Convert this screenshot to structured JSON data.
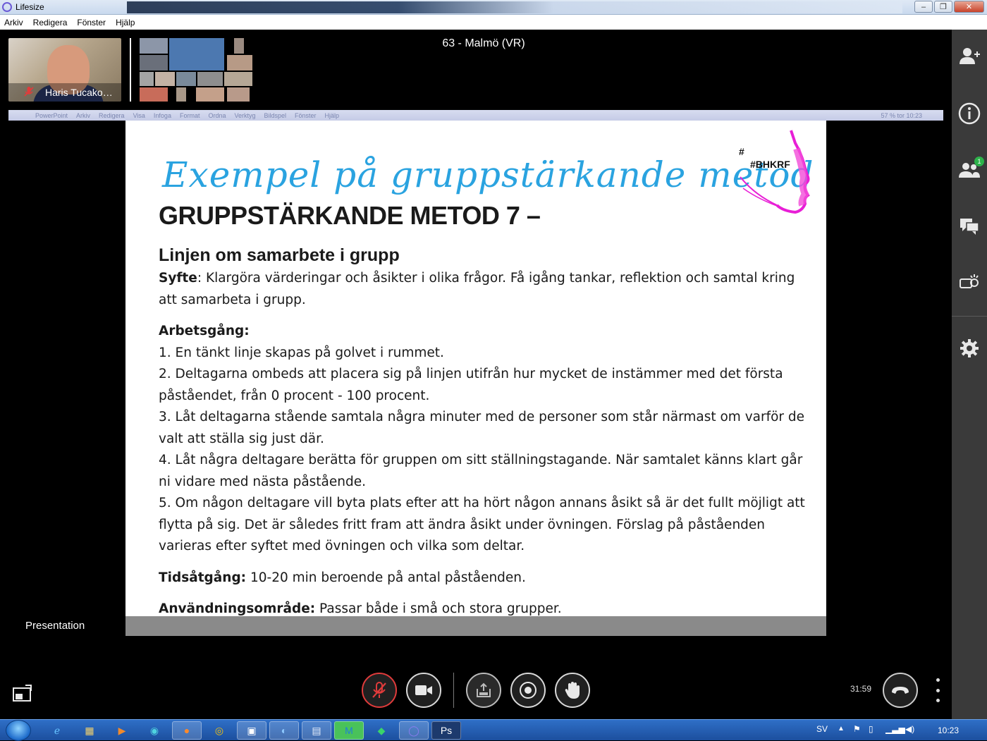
{
  "window": {
    "title": "Lifesize",
    "controls": {
      "minimize": "–",
      "maximize": "❐",
      "close": "✕"
    }
  },
  "menu": [
    "Arkiv",
    "Redigera",
    "Fönster",
    "Hjälp"
  ],
  "meeting": {
    "room_name": "63 - Malmö (VR)",
    "self_name": "Haris Tucako…",
    "presentation_label": "Presentation",
    "timer": "31:59"
  },
  "shared_screen": {
    "mac_menu": [
      "PowerPoint",
      "Arkiv",
      "Redigera",
      "Visa",
      "Infoga",
      "Format",
      "Ordna",
      "Verktyg",
      "Bildspel",
      "Fönster",
      "Hjälp"
    ],
    "mac_status": "57 %   tor 10:23",
    "slide": {
      "script_title": "Exempel på gruppstärkande metod",
      "heading": "GRUPPSTÄRKANDE METOD 7 –",
      "subheading": "Linjen om samarbete i grupp",
      "logo_hash": "#",
      "logo_tag": "#BHKRF",
      "syfte_label": "Syfte",
      "syfte_text": ": Klargöra värderingar och åsikter i olika frågor. Få igång tankar, reflektion och samtal kring att samarbeta i grupp.",
      "arbetsgang_label": "Arbetsgång:",
      "steps": [
        "1. En tänkt linje skapas på golvet i rummet.",
        "2. Deltagarna ombeds att placera sig på linjen utifrån hur mycket de instämmer med det första påståendet, från 0 procent - 100 procent.",
        "3. Låt deltagarna stående samtala några minuter med de personer som står närmast om varför de valt att ställa sig just där.",
        "4. Låt några deltagare berätta för gruppen om sitt ställningstagande. När samtalet känns klart går ni vidare med nästa påstående.",
        "5. Om någon deltagare vill byta plats efter att ha hört någon annans åsikt så är det fullt möjligt att flytta på sig. Det är således fritt fram att ändra åsikt under övningen. Förslag på påståenden varieras efter syftet med övningen och vilka som deltar."
      ],
      "tid_label": "Tidsåtgång:",
      "tid_text": " 10-20 min beroende på antal påståenden.",
      "anv_label": "Användningsområde:",
      "anv_text": " Passar både i små och stora grupper."
    }
  },
  "sidebar": {
    "participants_badge": "1",
    "icons": [
      "add-participant-icon",
      "info-icon",
      "participants-icon",
      "chat-icon",
      "camera-settings-icon",
      "settings-icon"
    ]
  },
  "controls": [
    "mute-mic",
    "camera",
    "share-screen",
    "record",
    "raise-hand",
    "hang-up"
  ],
  "taskbar": {
    "language": "SV",
    "clock": "10:23",
    "apps": [
      "internet-explorer",
      "file-explorer",
      "media-player",
      "edge",
      "firefox",
      "chrome",
      "save-tool",
      "skype",
      "notepad",
      "malwarebytes",
      "security",
      "lifesize",
      "photoshop"
    ]
  },
  "colors": {
    "accent_script_title": "#2aa3e0",
    "logo_magenta": "#e81ed6",
    "mute_red": "#e03b3b",
    "sidebar_bg": "#3a3a3a"
  }
}
